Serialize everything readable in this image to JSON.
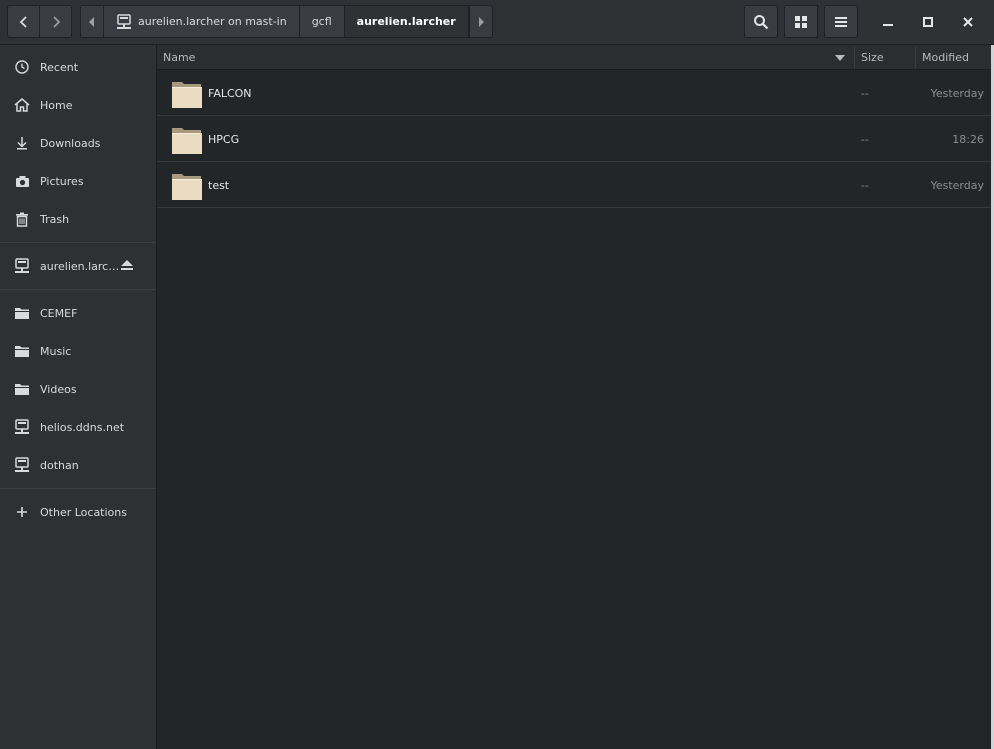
{
  "window": {
    "accent": "#2e3235"
  },
  "pathbar": {
    "crumbs": [
      {
        "label": "aurelien.larcher on mast-in",
        "icon": "network-drive-icon"
      },
      {
        "label": "gcfl"
      },
      {
        "label": "aurelien.larcher"
      }
    ]
  },
  "sidebar": {
    "places": [
      {
        "label": "Recent",
        "icon": "clock-icon"
      },
      {
        "label": "Home",
        "icon": "home-icon"
      },
      {
        "label": "Downloads",
        "icon": "download-icon"
      },
      {
        "label": "Pictures",
        "icon": "camera-icon"
      },
      {
        "label": "Trash",
        "icon": "trash-icon"
      }
    ],
    "mounts": [
      {
        "label": "aurelien.larc…",
        "icon": "network-drive-icon",
        "eject": "eject-icon"
      }
    ],
    "bookmarks": [
      {
        "label": "CEMEF",
        "icon": "folder-icon"
      },
      {
        "label": "Music",
        "icon": "folder-icon"
      },
      {
        "label": "Videos",
        "icon": "folder-icon"
      },
      {
        "label": "helios.ddns.net",
        "icon": "network-drive-icon"
      },
      {
        "label": "dothan",
        "icon": "network-drive-icon"
      }
    ],
    "other": {
      "label": "Other Locations",
      "icon": "plus-icon"
    }
  },
  "list": {
    "columns": {
      "name": "Name",
      "size": "Size",
      "modified": "Modified"
    },
    "rows": [
      {
        "name": "FALCON",
        "size": "--",
        "modified": "Yesterday"
      },
      {
        "name": "HPCG",
        "size": "--",
        "modified": "18:26"
      },
      {
        "name": "test",
        "size": "--",
        "modified": "Yesterday"
      }
    ]
  }
}
